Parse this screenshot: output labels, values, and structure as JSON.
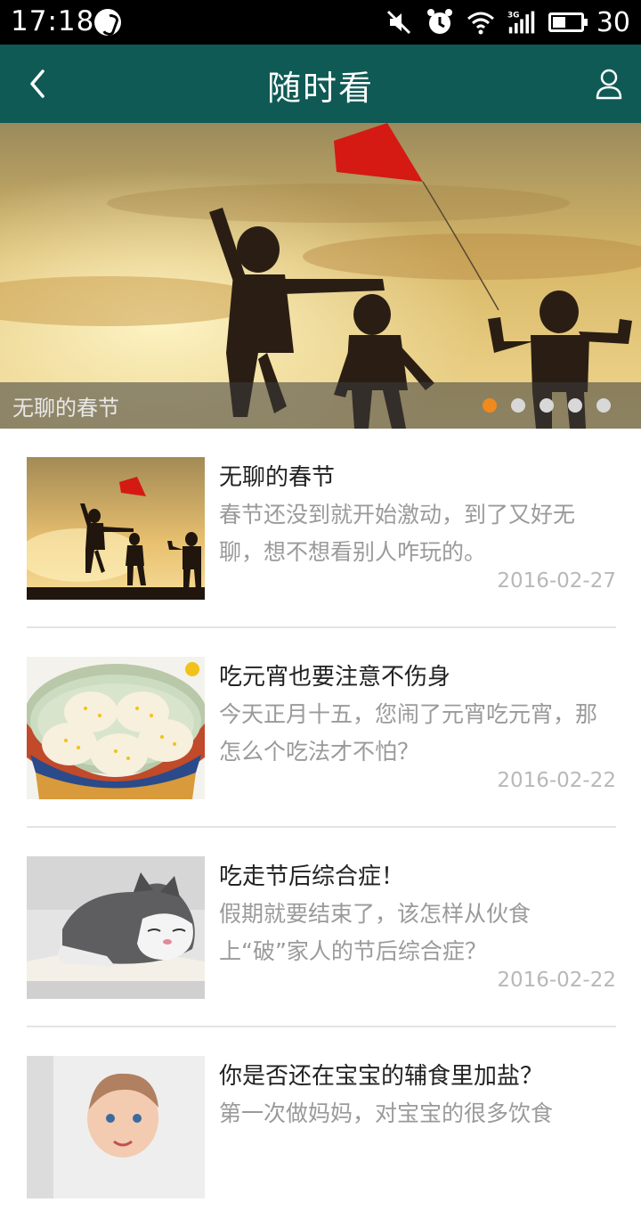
{
  "status_bar": {
    "time": "17:18",
    "battery": "30",
    "icons": [
      "mute-icon",
      "alarm-icon",
      "wifi-icon",
      "signal-3g-icon",
      "battery-icon"
    ]
  },
  "header": {
    "title": "随时看",
    "back_icon": "chevron-left-icon",
    "user_icon": "user-icon",
    "background_color": "#0f5a55"
  },
  "banner": {
    "caption": "无聊的春节",
    "slide_count": 5,
    "active_slide": 1,
    "active_dot_color": "#f08a1c"
  },
  "articles": [
    {
      "title": "无聊的春节",
      "summary": "春节还没到就开始激动，到了又好无聊，想不想看别人咋玩的。",
      "date": "2016-02-27",
      "thumb": "kids-kite-sunset"
    },
    {
      "title": "吃元宵也要注意不伤身",
      "summary": "今天正月十五，您闹了元宵吃元宵，那怎么个吃法才不怕？",
      "date": "2016-02-22",
      "thumb": "tangyuan-bowl"
    },
    {
      "title": "吃走节后综合症！",
      "summary": "假期就要结束了，该怎样从伙食上“破”家人的节后综合症？",
      "date": "2016-02-22",
      "thumb": "sleeping-cat"
    },
    {
      "title": "你是否还在宝宝的辅食里加盐？",
      "summary": "第一次做妈妈，对宝宝的很多饮食",
      "date": "",
      "thumb": "baby"
    }
  ]
}
